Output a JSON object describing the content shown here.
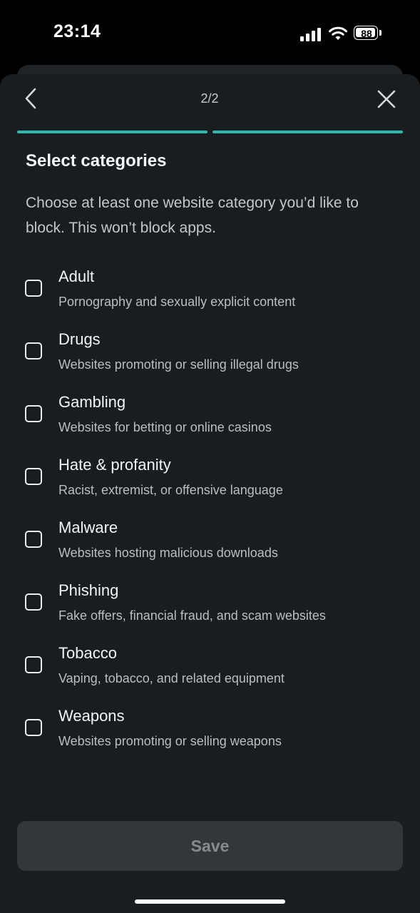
{
  "status_bar": {
    "time": "23:14",
    "battery": "88"
  },
  "nav": {
    "step": "2/2",
    "back_icon": "chevron-left-icon",
    "close_icon": "close-icon",
    "progress_color": "#2fb8ad",
    "progress_steps_completed": 2,
    "progress_steps_total": 2
  },
  "header": {
    "title": "Select categories",
    "description": "Choose at least one website category you’d like to block. This won’t block apps."
  },
  "categories": [
    {
      "name": "Adult",
      "description": "Pornography and sexually explicit content",
      "checked": false
    },
    {
      "name": "Drugs",
      "description": "Websites promoting or selling illegal drugs",
      "checked": false
    },
    {
      "name": "Gambling",
      "description": "Websites for betting or online casinos",
      "checked": false
    },
    {
      "name": "Hate & profanity",
      "description": "Racist, extremist, or offensive language",
      "checked": false
    },
    {
      "name": "Malware",
      "description": "Websites hosting malicious downloads",
      "checked": false
    },
    {
      "name": "Phishing",
      "description": "Fake offers, financial fraud, and scam websites",
      "checked": false
    },
    {
      "name": "Tobacco",
      "description": "Vaping, tobacco, and related equipment",
      "checked": false
    },
    {
      "name": "Weapons",
      "description": "Websites promoting or selling weapons",
      "checked": false
    }
  ],
  "footer": {
    "save_label": "Save"
  }
}
